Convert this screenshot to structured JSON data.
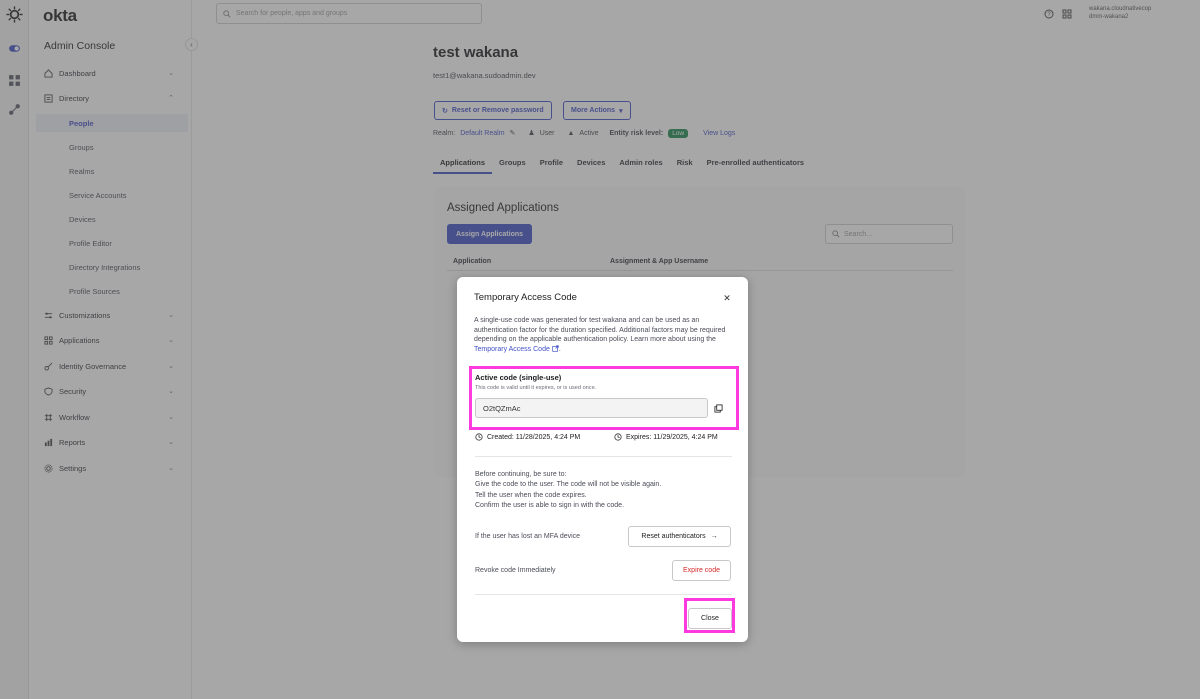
{
  "topbar": {
    "logo": "okta",
    "search_placeholder": "Search for people, apps and groups",
    "account_line1": "wakana.cloudnativecop",
    "account_line2": "dmm-wakana2"
  },
  "sidebar": {
    "title": "Admin Console",
    "items": [
      {
        "label": "Dashboard",
        "icon": "dashboard-icon"
      },
      {
        "label": "Directory",
        "icon": "directory-icon"
      },
      {
        "label": "Customizations",
        "icon": "customizations-icon"
      },
      {
        "label": "Applications",
        "icon": "applications-icon"
      },
      {
        "label": "Identity Governance",
        "icon": "identity-governance-icon"
      },
      {
        "label": "Security",
        "icon": "security-icon"
      },
      {
        "label": "Workflow",
        "icon": "workflow-icon"
      },
      {
        "label": "Reports",
        "icon": "reports-icon"
      },
      {
        "label": "Settings",
        "icon": "settings-icon"
      }
    ],
    "directory_sub": [
      "People",
      "Groups",
      "Realms",
      "Service Accounts",
      "Devices",
      "Profile Editor",
      "Directory Integrations",
      "Profile Sources"
    ]
  },
  "user": {
    "name": "test wakana",
    "email": "test1@wakana.sudoadmin.dev",
    "reset_button": "Reset or Remove password",
    "more_actions": "More Actions",
    "realm_label": "Realm:",
    "realm_value": "Default Realm",
    "type": "User",
    "status": "Active",
    "risk_label": "Entity risk level:",
    "risk_value": "Low",
    "view_logs": "View Logs"
  },
  "tabs": [
    "Applications",
    "Groups",
    "Profile",
    "Devices",
    "Admin roles",
    "Risk",
    "Pre-enrolled authenticators"
  ],
  "applications_panel": {
    "title": "Assigned Applications",
    "assign_button": "Assign Applications",
    "search_placeholder": "Search...",
    "col_application": "Application",
    "col_assignment": "Assignment & App Username"
  },
  "modal": {
    "title": "Temporary Access Code",
    "description": "A single-use code was generated for test wakana and can be used as an authentication factor for the duration specified. Additional factors may be required depending on the applicable authentication policy. Learn more about using the",
    "description_link": "Temporary Access Code",
    "code_label": "Active code (single-use)",
    "code_help": "This code is valid until it expires, or is used once.",
    "code_value": "O2tQZmAc",
    "created": "Created: 11/28/2025, 4:24 PM",
    "expires": "Expires: 11/29/2025, 4:24 PM",
    "before_intro": "Before continuing, be sure to:",
    "before_items": [
      "Give the code to the user. The code will not be visible again.",
      "Tell the user when the code expires.",
      "Confirm the user is able to sign in with the code."
    ],
    "lost_device_label": "If the user has lost an MFA device",
    "reset_authenticators": "Reset authenticators",
    "revoke_label": "Revoke code Immediately",
    "expire_button": "Expire code",
    "close_button": "Close"
  },
  "colors": {
    "accent": "#4050c6",
    "highlight": "#ff39e0",
    "risk_low": "#1c8a52",
    "danger": "#d22a2a"
  }
}
